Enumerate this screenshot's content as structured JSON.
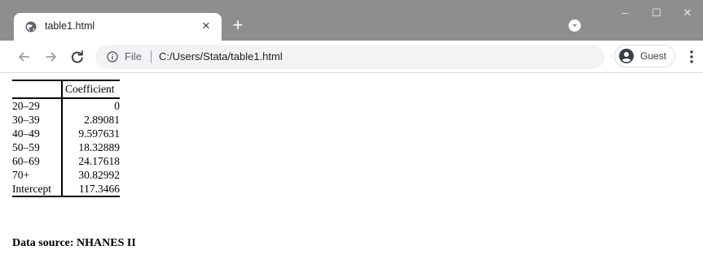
{
  "window": {
    "tab": {
      "title": "table1.html",
      "close_glyph": "×",
      "favicon": "globe-icon"
    },
    "new_tab_glyph": "+",
    "controls": {
      "minimize": "–",
      "maximize": "☐",
      "close": "✕"
    }
  },
  "toolbar": {
    "omnibox": {
      "scheme_label": "File",
      "url": "C:/Users/Stata/table1.html"
    },
    "profile": {
      "label": "Guest"
    }
  },
  "page": {
    "table": {
      "header": {
        "label": "",
        "value": "Coefficient"
      },
      "rows": [
        {
          "label": "20–29",
          "value": "0"
        },
        {
          "label": "30–39",
          "value": "2.89081"
        },
        {
          "label": "40–49",
          "value": "9.597631"
        },
        {
          "label": "50–59",
          "value": "18.32889"
        },
        {
          "label": "60–69",
          "value": "24.17618"
        },
        {
          "label": "70+",
          "value": "30.82992"
        },
        {
          "label": "Intercept",
          "value": "117.3466"
        }
      ]
    },
    "note": "Data source: NHANES II"
  },
  "colors": {
    "titlebar": "#8e8e8e",
    "omnibox": "#f1f3f4",
    "tab": "#ffffff"
  }
}
